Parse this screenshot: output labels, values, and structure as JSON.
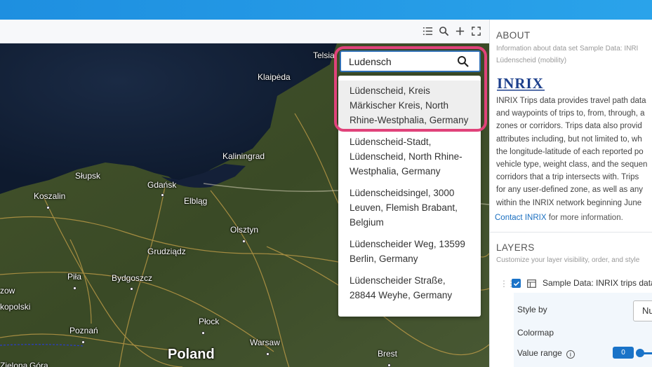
{
  "toolbar": {
    "icons": [
      "list-icon",
      "search-icon",
      "zoom-in-icon",
      "fullscreen-icon"
    ]
  },
  "map": {
    "cities": [
      {
        "name": "Telsiai",
        "dot": false
      },
      {
        "name": "Klaipėda",
        "dot": false
      },
      {
        "name": "Kaliningrad",
        "dot": false
      },
      {
        "name": "Słupsk",
        "dot": false
      },
      {
        "name": "Gdańsk",
        "dot": true
      },
      {
        "name": "Koszalin",
        "dot": true
      },
      {
        "name": "Elbląg",
        "dot": false
      },
      {
        "name": "Olsztyn",
        "dot": true
      },
      {
        "name": "Grudziądz",
        "dot": false
      },
      {
        "name": "Piła",
        "dot": true
      },
      {
        "name": "Bydgoszcz",
        "dot": true
      },
      {
        "name": "Płock",
        "dot": true
      },
      {
        "name": "Poznań",
        "dot": true
      },
      {
        "name": "Warsaw",
        "dot": true
      },
      {
        "name": "Brest",
        "dot": true
      },
      {
        "name": "Poland",
        "dot": false
      },
      {
        "name": "zow",
        "dot": false
      },
      {
        "name": "kopolski",
        "dot": false
      },
      {
        "name": "Góra",
        "dot": false
      },
      {
        "name": "Zielona",
        "dot": false
      }
    ]
  },
  "search": {
    "value": "Ludensch",
    "suggestions": [
      {
        "lines": [
          "Lüdenscheid, Kreis",
          "Märkischer Kreis, North",
          "Rhine-Westphalia, Germany"
        ]
      },
      {
        "lines": [
          "Lüdenscheid-Stadt,",
          "Lüdenscheid, North Rhine-",
          "Westphalia, Germany"
        ]
      },
      {
        "lines": [
          "Lüdenscheidsingel, 3000",
          "Leuven, Flemish Brabant,",
          "Belgium"
        ]
      },
      {
        "lines": [
          "Lüdenscheider Weg, 13599",
          "Berlin, Germany"
        ]
      },
      {
        "lines": [
          "Lüdenscheider Straße,",
          "28844 Weyhe, Germany"
        ]
      }
    ]
  },
  "about": {
    "title": "ABOUT",
    "sub1": "Information about data set Sample Data: INRI",
    "sub2": "Lüdenscheid (mobility)",
    "logo_text": "INRIX",
    "desc_lines": [
      "INRIX Trips data provides travel path data",
      "and waypoints of trips to, from, through, a",
      "zones or corridors. Trips data also provid",
      "attributes including, but not limited to, wh",
      "the longitude-latitude of each reported po",
      "vehicle type, weight class, and the sequen",
      "corridors that a trip intersects with. Trips",
      "for any user-defined zone, as well as any",
      "within the INRIX network beginning June"
    ],
    "contact_link": "Contact INRIX",
    "contact_rest": " for more information."
  },
  "layers": {
    "title": "LAYERS",
    "sub": "Customize your layer visibility, order, and style",
    "layer_name": "Sample Data: INRIX trips data",
    "style_by_label": "Style by",
    "style_by_value": "Nu",
    "colormap_label": "Colormap",
    "value_range_label": "Value range",
    "value_range_min": "0"
  },
  "colors": {
    "accent": "#1a73c8",
    "highlight_ring": "#e0427a",
    "topbar": "#2196e6"
  }
}
